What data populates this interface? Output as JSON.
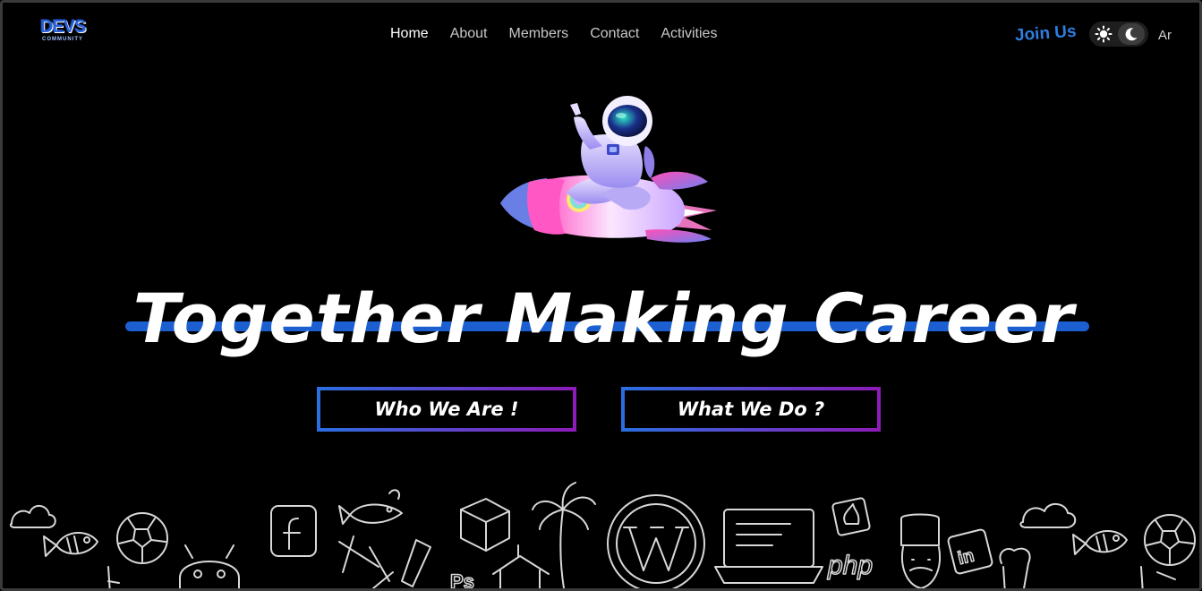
{
  "header": {
    "logo": {
      "text": "DEVS",
      "subtext": "COMMUNITY"
    },
    "nav": [
      {
        "label": "Home",
        "active": true
      },
      {
        "label": "About",
        "active": false
      },
      {
        "label": "Members",
        "active": false
      },
      {
        "label": "Contact",
        "active": false
      },
      {
        "label": "Activities",
        "active": false
      }
    ],
    "join_label": "Join Us",
    "theme_toggle": {
      "icons": [
        "sun-icon",
        "moon-icon"
      ],
      "selected": "dark"
    },
    "language_label": "Ar"
  },
  "hero": {
    "title": "Together Making Career",
    "buttons": {
      "who": "Who We Are !",
      "what": "What We Do ?"
    },
    "illustration": "astronaut-rocket-illustration"
  },
  "doodles": {
    "icons": [
      "cloud-icon",
      "fish-icon",
      "soccer-ball-icon",
      "android-icon",
      "facebook-icon",
      "fish-icon",
      "laravel-icon",
      "palm-tree-icon",
      "wordpress-icon",
      "laptop-icon",
      "codeigniter-icon",
      "php-icon",
      "chef-icon",
      "linkedin-icon",
      "cloud-icon",
      "fish-icon",
      "soccer-ball-icon"
    ],
    "labels": {
      "facebook": "f",
      "php": "php",
      "linkedin": "in",
      "photoshop": "Ps"
    }
  },
  "colors": {
    "background": "#000000",
    "accent_blue": "#1b5fd0",
    "gradient_start": "#2a6fe0",
    "gradient_end": "#8e1bb8",
    "join_blue": "#2f7de0"
  }
}
